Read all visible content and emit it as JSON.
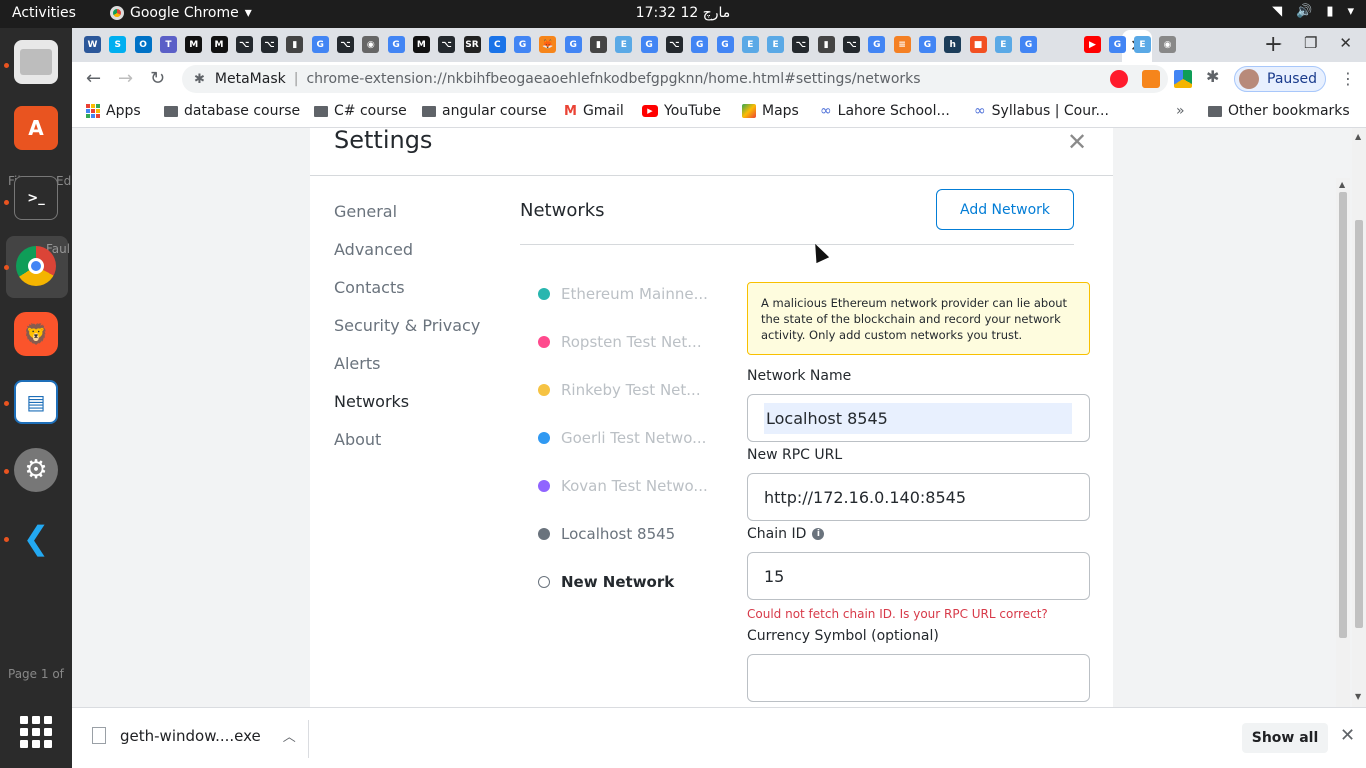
{
  "topbar": {
    "activities": "Activities",
    "app_name": "Google Chrome",
    "clock": "17:32  مارچ 12"
  },
  "dock": {
    "peek_file": "File",
    "peek_edit": "Ed",
    "peek_fault": "Faul",
    "peek_page": "Page 1 of"
  },
  "tabs": {
    "favicons": [
      {
        "glyph": "W",
        "color": "#2b579a"
      },
      {
        "glyph": "S",
        "color": "#00aff0"
      },
      {
        "glyph": "O",
        "color": "#0072c6"
      },
      {
        "glyph": "T",
        "color": "#5b5fc7"
      },
      {
        "glyph": "M",
        "color": "#111111"
      },
      {
        "glyph": "M",
        "color": "#111111"
      },
      {
        "glyph": "⌥",
        "color": "#24292e"
      },
      {
        "glyph": "⌥",
        "color": "#24292e"
      },
      {
        "glyph": "▮",
        "color": "#444444"
      },
      {
        "glyph": "G",
        "color": "#4285f4"
      },
      {
        "glyph": "⌥",
        "color": "#24292e"
      },
      {
        "glyph": "◉",
        "color": "#666666"
      },
      {
        "glyph": "G",
        "color": "#4285f4"
      },
      {
        "glyph": "M",
        "color": "#111111"
      },
      {
        "glyph": "⌥",
        "color": "#24292e"
      },
      {
        "glyph": "SR",
        "color": "#222222"
      },
      {
        "glyph": "C",
        "color": "#1a73e8"
      },
      {
        "glyph": "G",
        "color": "#4285f4"
      },
      {
        "glyph": "🦊",
        "color": "#f6851b"
      },
      {
        "glyph": "G",
        "color": "#4285f4"
      },
      {
        "glyph": "▮",
        "color": "#444444"
      },
      {
        "glyph": "E",
        "color": "#5aa9e6"
      },
      {
        "glyph": "G",
        "color": "#4285f4"
      },
      {
        "glyph": "⌥",
        "color": "#24292e"
      },
      {
        "glyph": "G",
        "color": "#4285f4"
      },
      {
        "glyph": "G",
        "color": "#4285f4"
      },
      {
        "glyph": "E",
        "color": "#5aa9e6"
      },
      {
        "glyph": "E",
        "color": "#5aa9e6"
      },
      {
        "glyph": "⌥",
        "color": "#24292e"
      },
      {
        "glyph": "▮",
        "color": "#444444"
      },
      {
        "glyph": "⌥",
        "color": "#24292e"
      },
      {
        "glyph": "G",
        "color": "#4285f4"
      },
      {
        "glyph": "≡",
        "color": "#f48024"
      },
      {
        "glyph": "G",
        "color": "#4285f4"
      },
      {
        "glyph": "h",
        "color": "#1c3d5a"
      },
      {
        "glyph": "■",
        "color": "#f25022"
      },
      {
        "glyph": "E",
        "color": "#5aa9e6"
      },
      {
        "glyph": "G",
        "color": "#4285f4"
      }
    ],
    "after_active": [
      {
        "glyph": "▶",
        "color": "#ff0000"
      },
      {
        "glyph": "G",
        "color": "#4285f4"
      },
      {
        "glyph": "E",
        "color": "#5aa9e6"
      },
      {
        "glyph": "◉",
        "color": "#888888"
      }
    ]
  },
  "toolbar": {
    "site_name": "MetaMask",
    "url": "chrome-extension://nkbihfbeogaeaoehlefnkodbefgpgknn/home.html#settings/networks",
    "profile_status": "Paused"
  },
  "bookmarks": [
    {
      "label": "Apps",
      "icon": "apps-icon"
    },
    {
      "label": "database course",
      "icon": "folder-icon"
    },
    {
      "label": "C# course",
      "icon": "folder-icon"
    },
    {
      "label": "angular course",
      "icon": "folder-icon"
    },
    {
      "label": "Gmail",
      "icon": "gmail-icon"
    },
    {
      "label": "YouTube",
      "icon": "youtube-icon"
    },
    {
      "label": "Maps",
      "icon": "maps-icon"
    },
    {
      "label": "Lahore School...",
      "icon": "link-icon"
    },
    {
      "label": "Syllabus | Cour...",
      "icon": "link-icon"
    }
  ],
  "other_bookmarks": "Other bookmarks",
  "settings": {
    "title": "Settings",
    "nav": [
      {
        "label": "General",
        "active": false
      },
      {
        "label": "Advanced",
        "active": false
      },
      {
        "label": "Contacts",
        "active": false
      },
      {
        "label": "Security & Privacy",
        "active": false
      },
      {
        "label": "Alerts",
        "active": false
      },
      {
        "label": "Networks",
        "active": true
      },
      {
        "label": "About",
        "active": false
      }
    ],
    "networks_heading": "Networks",
    "add_network": "Add Network",
    "networks": [
      {
        "label": "Ethereum Mainne...",
        "color": "#29b6af"
      },
      {
        "label": "Ropsten Test Net...",
        "color": "#ff4a8d"
      },
      {
        "label": "Rinkeby Test Net...",
        "color": "#f6c343"
      },
      {
        "label": "Goerli Test Netwo...",
        "color": "#3099f2"
      },
      {
        "label": "Kovan Test Netwo...",
        "color": "#9064ff"
      },
      {
        "label": "Localhost 8545",
        "color": "#6a737d"
      },
      {
        "label": "New Network",
        "color": "#ffffff"
      }
    ],
    "warning": "A malicious Ethereum network provider can lie about the state of the blockchain and record your network activity. Only add custom networks you trust.",
    "form": {
      "network_name_label": "Network Name",
      "network_name_value": "Localhost 8545",
      "rpc_label": "New RPC URL",
      "rpc_value": "http://172.16.0.140:8545",
      "chain_id_label": "Chain ID",
      "chain_id_value": "15",
      "chain_error": "Could not fetch chain ID. Is your RPC URL correct?",
      "currency_label": "Currency Symbol (optional)",
      "currency_value": ""
    }
  },
  "download": {
    "file": "geth-window....exe",
    "show_all": "Show all"
  }
}
